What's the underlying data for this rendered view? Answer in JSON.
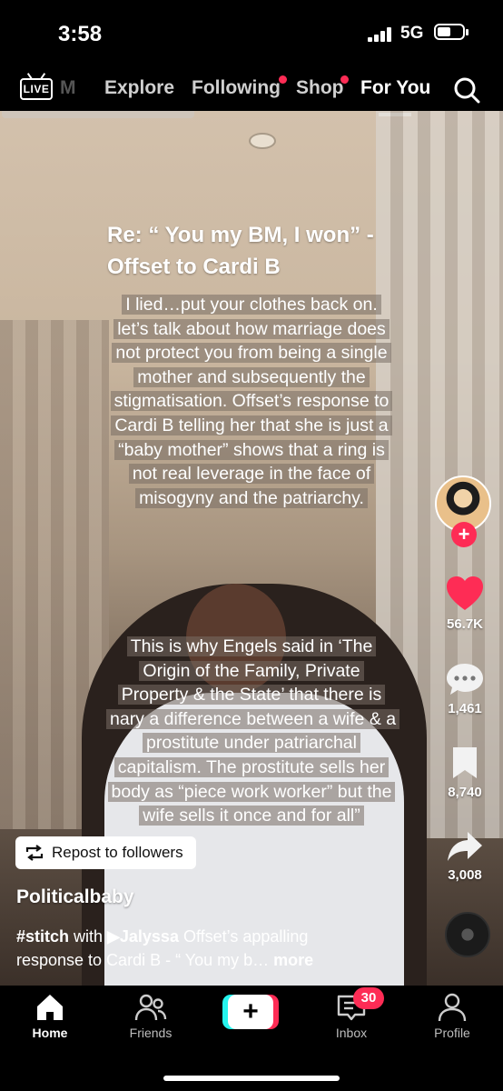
{
  "status_bar": {
    "time": "3:58",
    "network": "5G"
  },
  "top_nav": {
    "live_label": "LIVE",
    "tabs": [
      {
        "label": "M"
      },
      {
        "label": "Explore"
      },
      {
        "label": "Following"
      },
      {
        "label": "Shop"
      },
      {
        "label": "For You"
      }
    ]
  },
  "caption": {
    "title": "Re: “ You my BM, I won” - Offset to Cardi B",
    "paragraph1": "I lied…put your clothes back on. let’s talk about how marriage does not protect you from being a single mother and subsequently the stigmatisation. Offset’s response to Cardi B telling her that she is just a “baby mother” shows that a ring is not real leverage in the face of misogyny and the patriarchy.",
    "paragraph2": "This is why Engels said in ‘The Origin of the Family, Private Property & the State’ that there is nary a difference between a wife & a prostitute under patriarchal capitalism. The prostitute sells her body as “piece work worker” but the wife sells it once and for all”"
  },
  "side_rail": {
    "likes": "56.7K",
    "comments": "1,461",
    "saves": "8,740",
    "shares": "3,008"
  },
  "post": {
    "repost_label": "Repost to followers",
    "username": "Politicalbaby",
    "hashtag": "#stitch",
    "with_text": " with ",
    "stitched_user": "▶Jalyssa",
    "description": "  Offset’s appalling response to Cardi B - “ You my b… ",
    "more": "more"
  },
  "bottom_nav": {
    "items": [
      {
        "label": "Home"
      },
      {
        "label": "Friends"
      },
      {
        "label": ""
      },
      {
        "label": "Inbox"
      },
      {
        "label": "Profile"
      }
    ],
    "inbox_badge": "30"
  },
  "colors": {
    "accent": "#fe2c55",
    "cyan": "#25f4ee",
    "background": "#000000"
  }
}
